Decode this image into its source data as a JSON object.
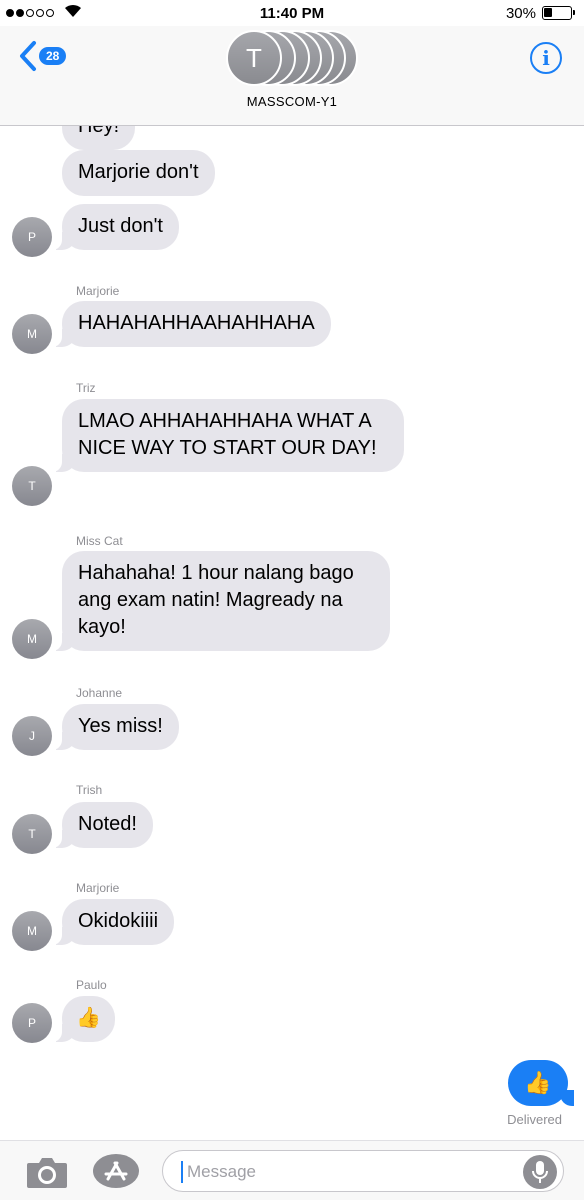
{
  "status_bar": {
    "time": "11:40 PM",
    "battery": "30%",
    "battery_level": 0.3
  },
  "header": {
    "back_badge": "28",
    "avatar_initial": "T",
    "group_name": "MASSCOM-Y1",
    "info_icon": "i"
  },
  "messages": [
    {
      "text": "Hey!",
      "avatar": ""
    },
    {
      "text": "Marjorie don't",
      "avatar": ""
    },
    {
      "text": "Just don't",
      "avatar": "P"
    },
    {
      "sender": "Marjorie",
      "text": "HAHAHAHHAAHAHHAHA",
      "avatar": "M"
    },
    {
      "sender": "Triz",
      "text": "LMAO AHHAHAHHAHA WHAT A NICE WAY TO START OUR DAY!",
      "avatar": "T"
    },
    {
      "sender": "Miss Cat",
      "text": "Hahahaha! 1 hour nalang bago ang exam natin! Magready na kayo!",
      "avatar": "M"
    },
    {
      "sender": "Johanne",
      "text": "Yes miss!",
      "avatar": "J"
    },
    {
      "sender": "Trish",
      "text": "Noted!",
      "avatar": "T"
    },
    {
      "sender": "Marjorie",
      "text": "Okidokiiii",
      "avatar": "M"
    },
    {
      "sender": "Paulo",
      "text": "👍",
      "avatar": "P"
    }
  ],
  "sent_message": {
    "text": "👍",
    "status": "Delivered"
  },
  "input_bar": {
    "placeholder": "Message"
  },
  "icons": [
    "wifi-icon",
    "battery-icon",
    "back-chevron-icon",
    "info-icon",
    "camera-icon",
    "app-store-icon",
    "microphone-icon"
  ],
  "colors": {
    "accent": "#1a7ff5",
    "bubble_received": "#e6e5eb",
    "avatar": "#8e8e93"
  }
}
